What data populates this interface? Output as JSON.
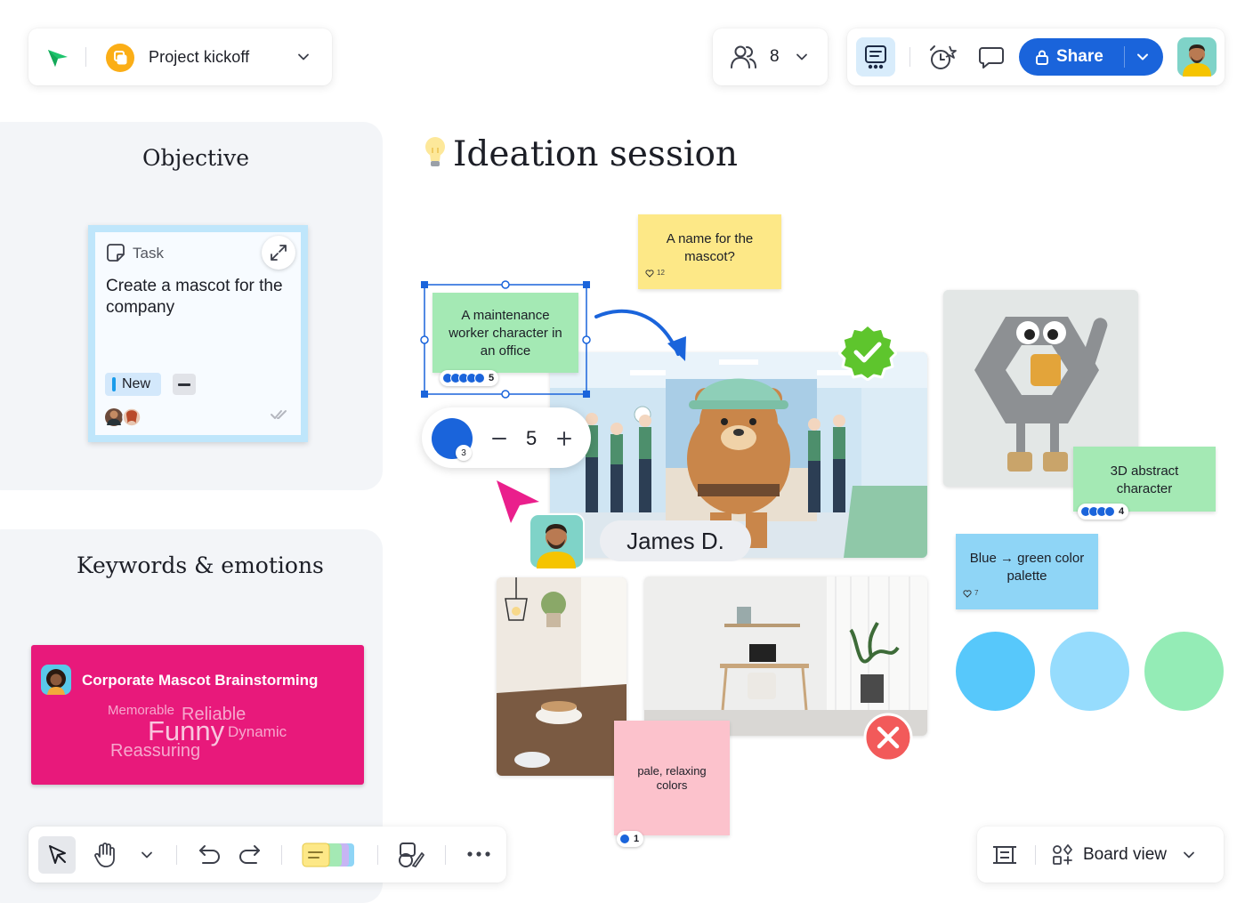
{
  "header": {
    "board_title": "Project kickoff",
    "collaborators_count": "8",
    "share_label": "Share"
  },
  "objective": {
    "title": "Objective",
    "task": {
      "type_label": "Task",
      "text": "Create a mascot for the company",
      "status": "New"
    }
  },
  "keywords": {
    "title": "Keywords & emotions",
    "card_title": "Corporate Mascot Brainstorming",
    "words": [
      "Memorable",
      "Reliable",
      "Funny",
      "Dynamic",
      "Reassuring"
    ],
    "card_color": "#e8197b"
  },
  "canvas": {
    "heading": "Ideation session",
    "stickies": [
      {
        "id": "mascot-name",
        "text": "A name for the mascot?",
        "likes": "12",
        "color": "#fde887"
      },
      {
        "id": "maintenance",
        "text": "A maintenance worker character in an office",
        "votes": "5",
        "color": "#a4e9b4"
      },
      {
        "id": "abstract",
        "text": "3D abstract character",
        "votes": "4",
        "color": "#a4e9b4"
      },
      {
        "id": "palette",
        "text": "Blue → green color palette",
        "likes": "7",
        "color": "#8fd5f6"
      },
      {
        "id": "pale",
        "text": "pale, relaxing colors",
        "votes": "1",
        "color": "#fcc2cc"
      }
    ],
    "vote_widget": {
      "value": "5",
      "badge": "3"
    },
    "cursor_user": "James D.",
    "palette_colors": [
      "#57c8fb",
      "#96dcfd",
      "#94ecb6"
    ]
  },
  "footer": {
    "board_view_label": "Board view"
  },
  "colors": {
    "accent": "#1a64db",
    "frame_bg": "#f3f5f8",
    "cursor": "#ea1f8c",
    "approve": "#5ec52d",
    "reject": "#f25a5a"
  }
}
